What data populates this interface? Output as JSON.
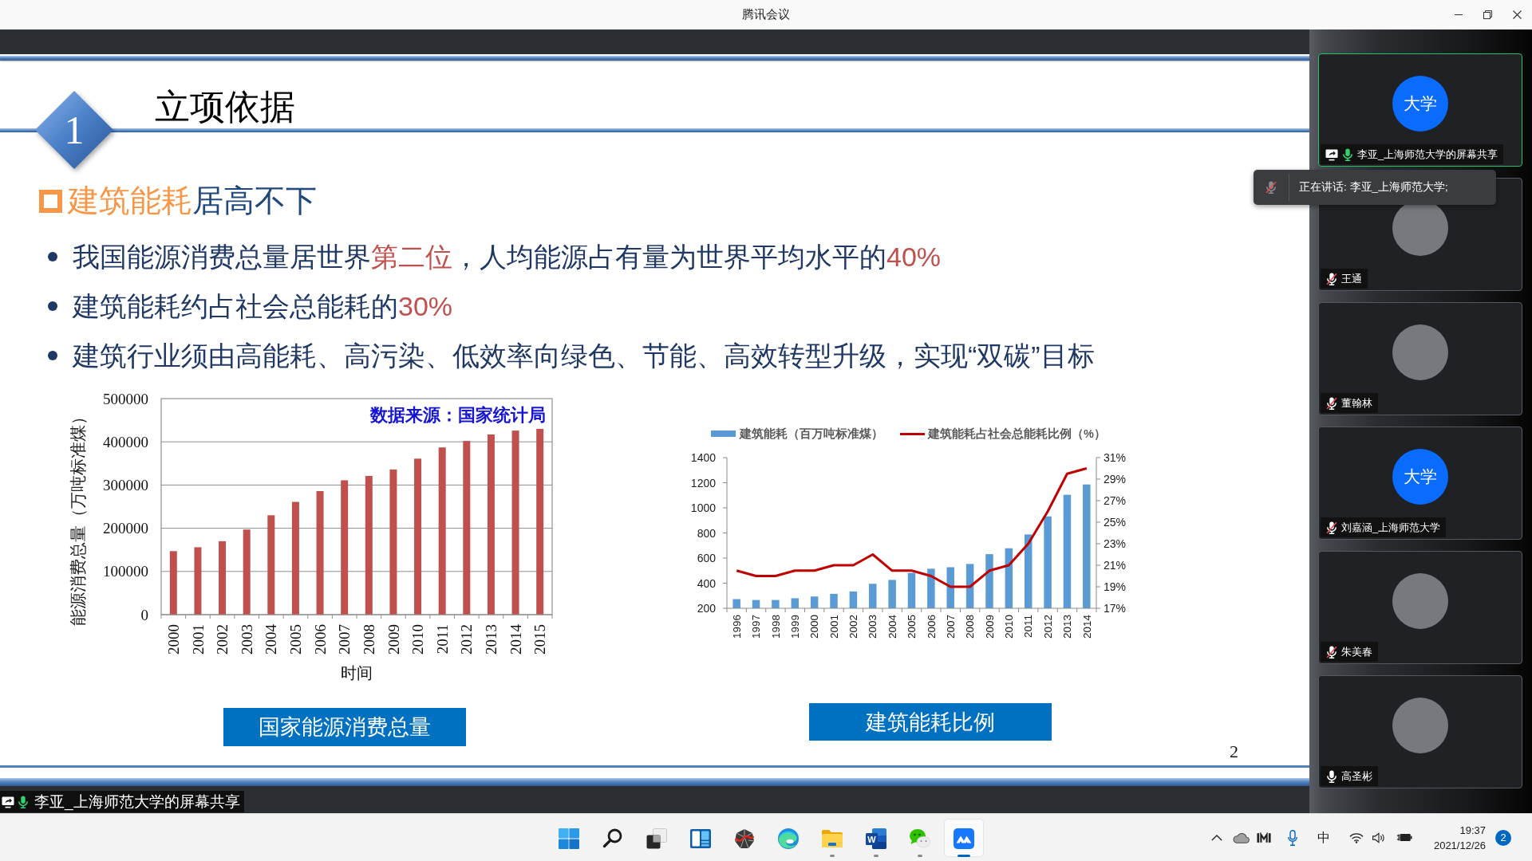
{
  "window": {
    "title": "腾讯会议"
  },
  "slide": {
    "section_number": "1",
    "title": "立项依据",
    "subtitle": {
      "segments": [
        {
          "text": "建筑能耗",
          "highlight": true
        },
        {
          "text": "居高不下",
          "highlight": false
        }
      ]
    },
    "bullets": [
      {
        "segments": [
          {
            "text": "我国能源消费总量居世界",
            "highlight": false
          },
          {
            "text": "第二位",
            "highlight": true
          },
          {
            "text": "，人均能源占有量为世界平均水平的",
            "highlight": false
          },
          {
            "text": "40%",
            "highlight": true
          }
        ]
      },
      {
        "segments": [
          {
            "text": "建筑能耗约占社会总能耗的",
            "highlight": false
          },
          {
            "text": "30%",
            "highlight": true
          }
        ]
      },
      {
        "segments": [
          {
            "text": "建筑行业须由高能耗、高污染、低效率向绿色、节能、高效转型升级，实现“双碳”目标",
            "highlight": false
          }
        ]
      }
    ],
    "left_chart": {
      "chart_data": {
        "type": "bar",
        "xlabel": "时间",
        "ylabel": "能源消费总量（万吨标准煤）",
        "categories": [
          "2000",
          "2001",
          "2002",
          "2003",
          "2004",
          "2005",
          "2006",
          "2007",
          "2008",
          "2009",
          "2010",
          "2011",
          "2012",
          "2013",
          "2014",
          "2015"
        ],
        "series": [
          {
            "color": "#c0504d",
            "values": [
              147000,
              156000,
              170000,
              197000,
              230000,
              261000,
              286000,
              311000,
              321000,
              336000,
              361000,
              387000,
              402000,
              417000,
              426000,
              430000
            ]
          }
        ],
        "ylim": [
          0,
          500000
        ],
        "yticks": [
          0,
          100000,
          200000,
          300000,
          400000,
          500000
        ],
        "grid": true,
        "annotations": [
          {
            "text": "数据来源：国家统计局"
          }
        ]
      },
      "caption": "国家能源消费总量"
    },
    "right_chart": {
      "chart_data": {
        "type": "bar",
        "categories": [
          "1996",
          "1997",
          "1998",
          "1999",
          "2000",
          "2001",
          "2002",
          "2003",
          "2004",
          "2005",
          "2006",
          "2007",
          "2008",
          "2009",
          "2010",
          "2011",
          "2012",
          "2013",
          "2014"
        ],
        "series": [
          {
            "name": "建筑能耗（百万吨标准煤）",
            "color": "#5b9bd5",
            "values": [
              273,
              266,
              266,
              280,
              294,
              315,
              334,
              395,
              426,
              482,
              515,
              527,
              553,
              631,
              678,
              788,
              932,
              1104,
              1186
            ]
          },
          {
            "type": "line",
            "axis": "y2",
            "name": "建筑能耗占社会总能耗比例（%）",
            "color": "#c00000",
            "values": [
              20.5,
              20,
              20,
              20.5,
              20.5,
              21,
              21,
              22,
              20.5,
              20.5,
              20,
              19,
              19,
              20.5,
              21,
              23,
              26,
              29.5,
              30
            ]
          }
        ],
        "ylim": [
          200,
          1400
        ],
        "yticks": [
          200,
          400,
          600,
          800,
          1000,
          1200,
          1400
        ],
        "y2lim": [
          17,
          31
        ],
        "y2ticks": [
          {
            "value": 17,
            "label": "17%"
          },
          {
            "value": 19,
            "label": "19%"
          },
          {
            "value": 21,
            "label": "21%"
          },
          {
            "value": 23,
            "label": "23%"
          },
          {
            "value": 25,
            "label": "25%"
          },
          {
            "value": 27,
            "label": "27%"
          },
          {
            "value": 29,
            "label": "29%"
          },
          {
            "value": 31,
            "label": "31%"
          }
        ]
      },
      "caption": "建筑能耗比例"
    },
    "page_number": "2"
  },
  "share_label": {
    "text": "李亚_上海师范大学的屏幕共享",
    "speaking": true
  },
  "participants": [
    {
      "name": "李亚_上海师范大学的屏幕共享",
      "avatar": {
        "kind": "text",
        "text": "大学"
      },
      "sharing": true,
      "muted": false,
      "speaking": true
    },
    {
      "name": "王通",
      "avatar": {
        "kind": "photo"
      },
      "sharing": false,
      "muted": true,
      "speaking": false
    },
    {
      "name": "董翰林",
      "avatar": {
        "kind": "photo"
      },
      "sharing": false,
      "muted": true,
      "speaking": false
    },
    {
      "name": "刘嘉涵_上海师范大学",
      "avatar": {
        "kind": "text",
        "text": "大学"
      },
      "sharing": false,
      "muted": true,
      "speaking": false
    },
    {
      "name": "朱美春",
      "avatar": {
        "kind": "photo"
      },
      "sharing": false,
      "muted": true,
      "speaking": false
    },
    {
      "name": "高圣彬",
      "avatar": {
        "kind": "photo"
      },
      "sharing": false,
      "muted": false,
      "speaking": false
    }
  ],
  "speaking_tooltip": {
    "text": "正在讲话: 李亚_上海师范大学;"
  },
  "taskbar": {
    "apps": [
      {
        "kind": "start",
        "running": false,
        "active": false
      },
      {
        "kind": "search",
        "running": false,
        "active": false
      },
      {
        "kind": "taskview",
        "running": false,
        "active": false
      },
      {
        "kind": "widgets",
        "running": false,
        "active": false
      },
      {
        "kind": "polyhedron",
        "running": false,
        "active": false
      },
      {
        "kind": "swirl",
        "running": false,
        "active": false
      },
      {
        "kind": "folder",
        "running": true,
        "active": false
      },
      {
        "kind": "document",
        "label": "W",
        "running": true,
        "active": false
      },
      {
        "kind": "chat",
        "running": true,
        "active": false
      },
      {
        "kind": "meeting",
        "running": true,
        "active": true
      }
    ],
    "tray": {
      "ime": "中",
      "time": "19:37",
      "date": "2021/12/26",
      "notifications": "2"
    }
  }
}
